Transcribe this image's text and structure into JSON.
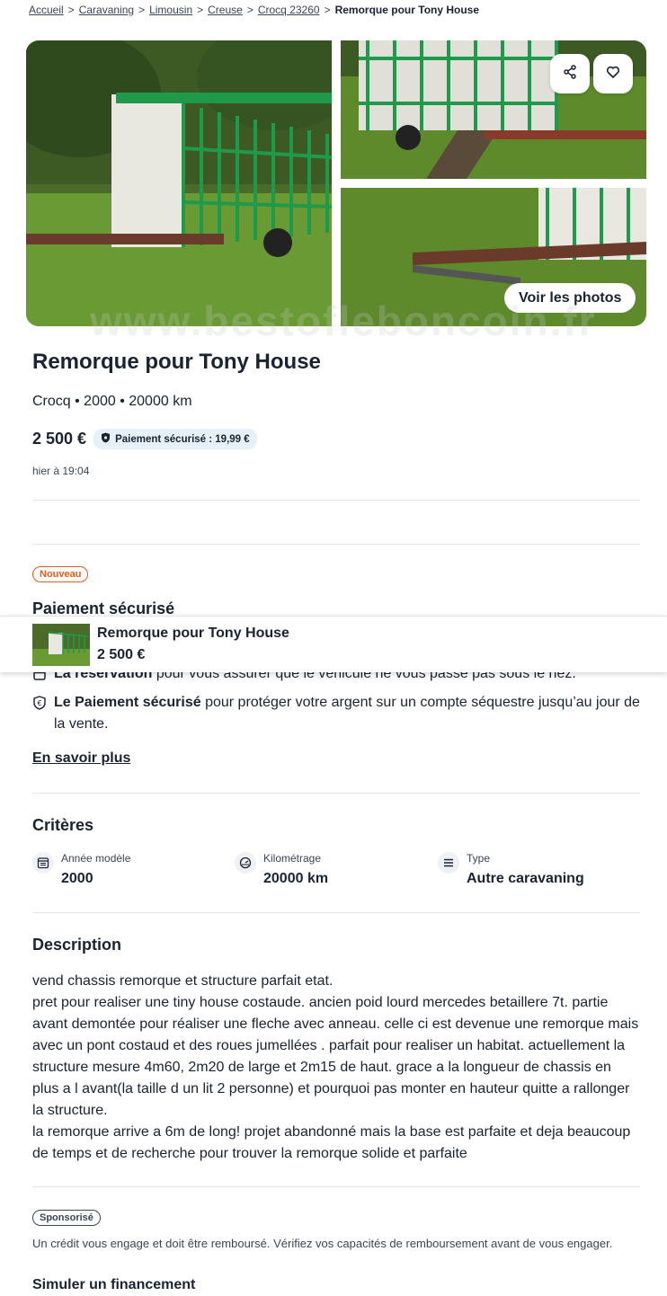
{
  "breadcrumb": {
    "items": [
      "Accueil",
      "Caravaning",
      "Limousin",
      "Creuse",
      "Crocq 23260"
    ],
    "separator": ">",
    "current": "Remorque pour Tony House"
  },
  "gallery": {
    "see_photos_label": "Voir les photos",
    "share_icon": "share-icon",
    "favorite_icon": "heart-icon",
    "watermark": "www.bestofleboncoin.fr"
  },
  "ad": {
    "title": "Remorque pour Tony House",
    "subtitle": "Crocq • 2000 • 20000 km",
    "price": "2 500 €",
    "secure_payment_badge": "Paiement sécurisé : 19,99 €",
    "date": "hier à 19:04"
  },
  "secure_section": {
    "new_badge": "Nouveau",
    "heading": "Paiement sécurisé",
    "features": [
      {
        "bold": "La réservation",
        "text": " pour vous assurer que le véhicule ne vous passe pas sous le nez."
      },
      {
        "bold": "Le Paiement sécurisé",
        "text": " pour protéger votre argent sur un compte séquestre jusqu’au jour de la vente."
      }
    ],
    "learn_more": "En savoir plus"
  },
  "sticky_bar": {
    "title": "Remorque pour Tony House",
    "price": "2 500 €"
  },
  "criteria": {
    "heading": "Critères",
    "items": [
      {
        "label": "Année modèle",
        "value": "2000",
        "icon": "calendar-icon"
      },
      {
        "label": "Kilométrage",
        "value": "20000 km",
        "icon": "odometer-icon"
      },
      {
        "label": "Type",
        "value": "Autre caravaning",
        "icon": "list-icon"
      }
    ]
  },
  "description": {
    "heading": "Description",
    "text": "vend chassis remorque et structure parfait etat.\npret pour realiser une tiny house costaude. ancien poid lourd mercedes betaillere 7t. partie avant demontée pour réaliser une fleche avec anneau. celle ci est devenue une remorque mais avec un pont costaud et des roues jumellées . parfait pour realiser un habitat. actuellement la structure mesure 4m60, 2m20 de large et 2m15 de haut. grace a la longueur de chassis en plus a l avant(la taille d un lit 2 personne) et pourquoi pas monter en hauteur quitte a rallonger la structure.\nla remorque arrive a 6m de long! projet abandonné mais la base est parfaite et deja beaucoup de temps et de recherche pour trouver la remorque solide et parfaite"
  },
  "sponsored": {
    "badge": "Sponsorisé",
    "credit_notice": "Un crédit vous engage et doit être remboursé. Vérifiez vos capacités de remboursement avant de vous engager.",
    "simulate_label": "Simuler un financement"
  },
  "colors": {
    "text": "#1a2332",
    "accent_orange": "#ec5a13",
    "badge_blue": "#e6f0fb",
    "trailer_green": "#1f9a4a",
    "grass": "#5e8a2c"
  }
}
